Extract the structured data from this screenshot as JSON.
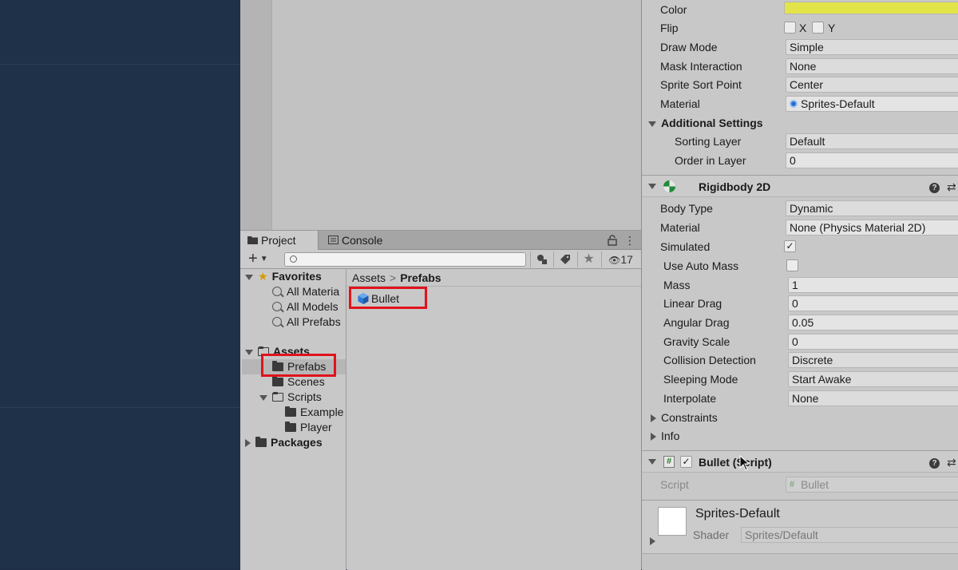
{
  "project": {
    "tabs": [
      {
        "label": "Project",
        "icon": "folder-icon"
      },
      {
        "label": "Console",
        "icon": "console-icon"
      }
    ],
    "toolbar": {
      "add_label": "+",
      "search_placeholder": "",
      "hidden_count": "17"
    },
    "tree": {
      "favorites_label": "Favorites",
      "favorites": [
        "All Materia",
        "All Models",
        "All Prefabs"
      ],
      "assets_label": "Assets",
      "assets_children": [
        "Prefabs",
        "Scenes"
      ],
      "scripts_label": "Scripts",
      "scripts_children": [
        "Example",
        "Player"
      ],
      "packages_label": "Packages"
    },
    "breadcrumb": {
      "root": "Assets",
      "current": "Prefabs"
    },
    "items": [
      {
        "label": "Bullet",
        "icon": "prefab-cube-icon"
      }
    ]
  },
  "inspector": {
    "sprite_renderer": {
      "color_label": "Color",
      "color_value": "#e2e44a",
      "flip_label": "Flip",
      "flip_x": "X",
      "flip_y": "Y",
      "draw_mode_label": "Draw Mode",
      "draw_mode": "Simple",
      "mask_label": "Mask Interaction",
      "mask": "None",
      "sort_point_label": "Sprite Sort Point",
      "sort_point": "Center",
      "material_label": "Material",
      "material": "Sprites-Default",
      "additional_label": "Additional Settings",
      "sorting_layer_label": "Sorting Layer",
      "sorting_layer": "Default",
      "order_label": "Order in Layer",
      "order": "0"
    },
    "rigidbody": {
      "title": "Rigidbody 2D",
      "body_type_label": "Body Type",
      "body_type": "Dynamic",
      "material_label": "Material",
      "material": "None (Physics Material 2D)",
      "simulated_label": "Simulated",
      "simulated": true,
      "auto_mass_label": "Use Auto Mass",
      "auto_mass": false,
      "mass_label": "Mass",
      "mass": "1",
      "linear_drag_label": "Linear Drag",
      "linear_drag": "0",
      "angular_drag_label": "Angular Drag",
      "angular_drag": "0.05",
      "gravity_label": "Gravity Scale",
      "gravity": "0",
      "collision_label": "Collision Detection",
      "collision": "Discrete",
      "sleeping_label": "Sleeping Mode",
      "sleeping": "Start Awake",
      "interpolate_label": "Interpolate",
      "interpolate": "None",
      "constraints_label": "Constraints",
      "info_label": "Info"
    },
    "script_component": {
      "title": "Bullet (Script)",
      "script_label": "Script",
      "script_value": "Bullet"
    },
    "material_preview": {
      "name": "Sprites-Default",
      "shader_label": "Shader",
      "shader": "Sprites/Default"
    }
  }
}
